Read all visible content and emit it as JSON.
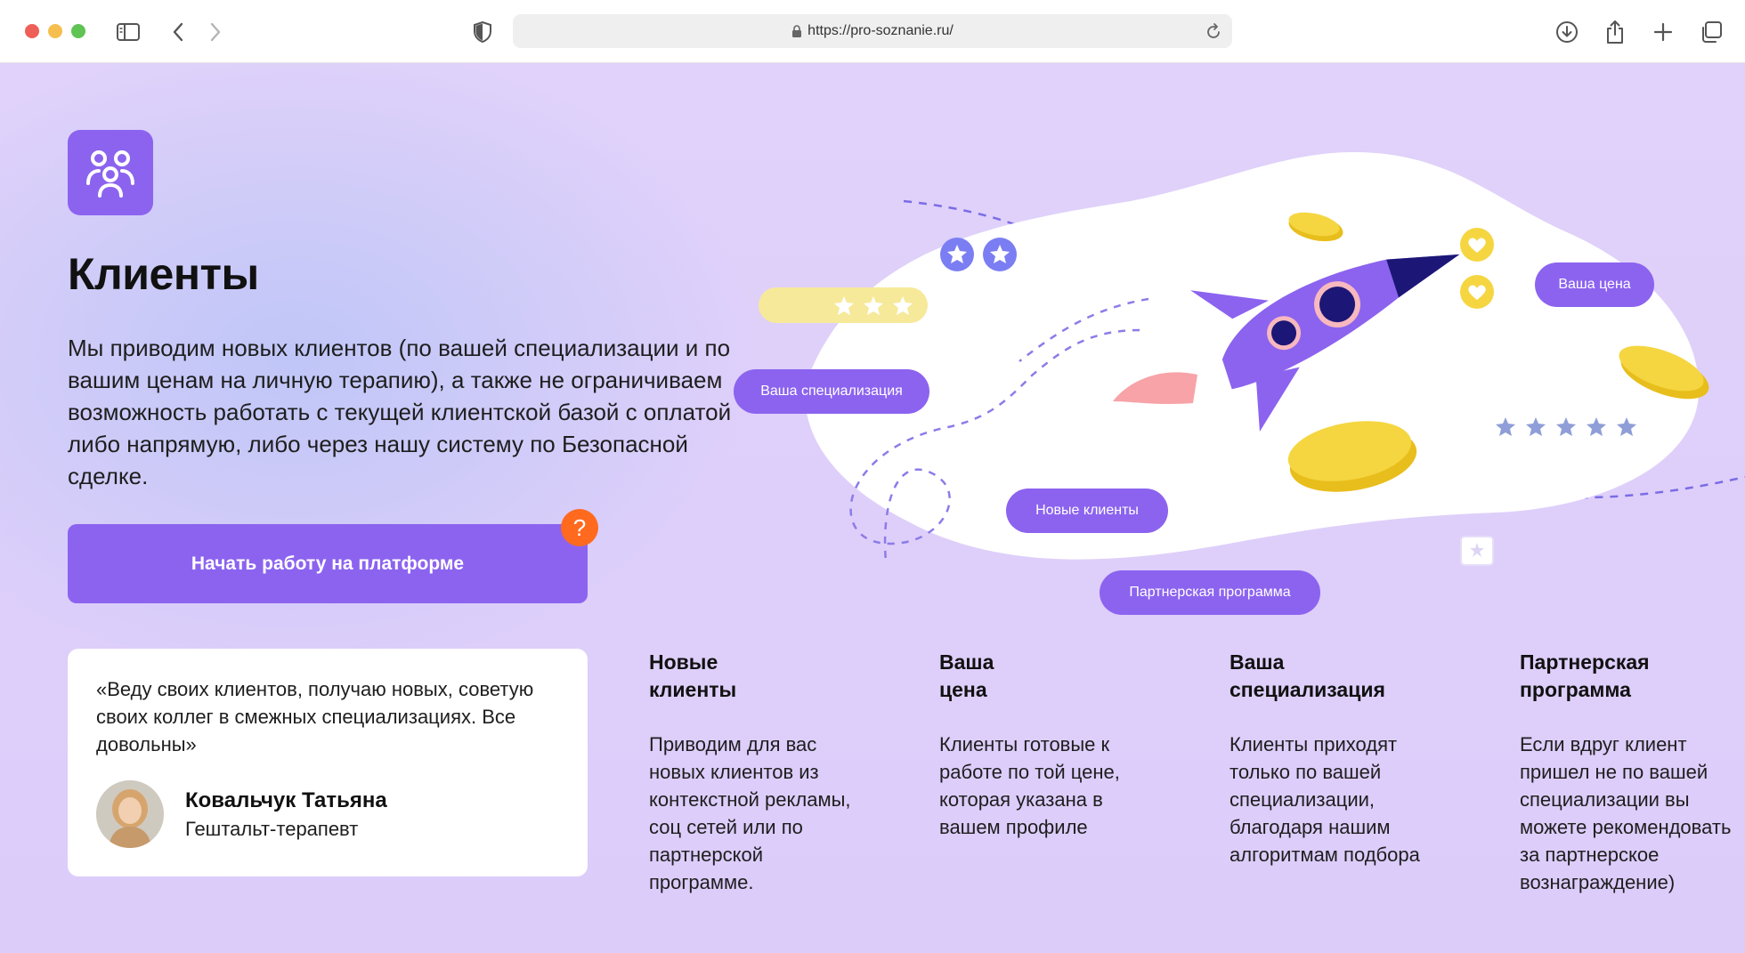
{
  "browser": {
    "url": "https://pro-soznanie.ru/"
  },
  "hero": {
    "title": "Клиенты",
    "lead": "Мы приводим новых клиентов (по вашей специализации и по вашим ценам на личную терапию), а также не ограничиваем возможность работать с текущей клиентской базой с оплатой либо напрямую, либо через нашу систему по Безопасной сделке.",
    "cta_label": "Начать работу на платформе",
    "help_label": "?"
  },
  "illustration": {
    "tags": {
      "price": "Ваша цена",
      "specialization": "Ваша специализация",
      "new_clients": "Новые клиенты",
      "partner": "Партнерская программа"
    },
    "rating_stars": 5
  },
  "review": {
    "quote": "«Веду своих клиентов, получаю новых, советую своих коллег в смежных специализациях. Все довольны»",
    "name": "Ковальчук Татьяна",
    "role": "Гештальт-терапевт"
  },
  "features": [
    {
      "title": "Новые\nклиенты",
      "text": "Приводим для вас новых клиентов из контекстной рекламы, соц сетей или по партнерской программе."
    },
    {
      "title": "Ваша\nцена",
      "text": "Клиенты готовые к работе по той цене, которая указана в вашем профиле"
    },
    {
      "title": "Ваша\nспециализация",
      "text": "Клиенты приходят только по вашей специализации, благодаря нашим алгоритмам подбора"
    },
    {
      "title": "Партнерская\nпрограмма",
      "text": "Если вдруг клиент пришел не по вашей специализации вы можете рекомендовать за партнерское вознаграждение)"
    }
  ],
  "colors": {
    "accent": "#8c63ef",
    "help": "#ff6a1f",
    "coin": "#f5cf2c",
    "background": "#dcccfa"
  }
}
